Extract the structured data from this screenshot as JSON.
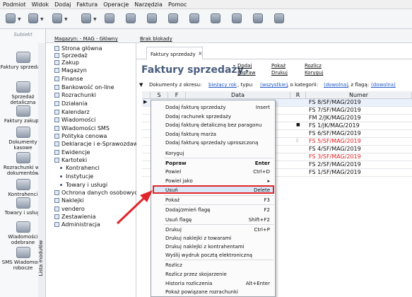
{
  "menubar": [
    "Podmiot",
    "Widok",
    "Dodaj",
    "Faktura",
    "Operacje",
    "Narzędzia",
    "Pomoc"
  ],
  "subiekt": {
    "logo": "Subiekt",
    "items": [
      "Faktury sprzedaży",
      "Sprzedaż detaliczna",
      "Faktury zakupu",
      "Dokumenty kasowe",
      "Rozrachunki wg dokumentów",
      "Kontrahenci",
      "Towary i usługi",
      "Wiadomości odebrane",
      "SMS Wiadomości robocze"
    ]
  },
  "magbar": {
    "magazyn": "Magazyn: - MAG - Główny",
    "blokady": "Brak blokady"
  },
  "vtab": "Lista modułów",
  "tree": {
    "items": [
      "Strona główna",
      "Sprzedaż",
      "Zakup",
      "Magazyn",
      "Finanse",
      "Bankowość on-line",
      "Rozrachunki",
      "Działania",
      "Kalendarz",
      "Wiadomości",
      "Wiadomości SMS",
      "Polityka cenowa",
      "Deklaracje i e-Sprawozdawczość",
      "Ewidencje",
      "Kartoteki"
    ],
    "sub": [
      "Kontrahenci",
      "Instytucje",
      "Towary i usługi"
    ],
    "items2": [
      "Ochrona danych osobowych",
      "Naklejki",
      "vendero",
      "Zestawienia",
      "Administracja"
    ]
  },
  "tab": {
    "label": "Faktury sprzedaży",
    "close": "×"
  },
  "title": "Faktury sprzedaży",
  "header_links": {
    "dodaj": "Dodaj",
    "popraw": "Popraw",
    "pokaz": "Pokaż",
    "drukuj": "Drukuj",
    "rozlicz": "Rozlicz",
    "koryguj": "Koryguj"
  },
  "filter": {
    "label1": "Dokumenty z okresu:",
    "okres": "bieżący rok",
    "label2": ", typu:",
    "typ": "(wszystkie)",
    "label3": ", o kategorii:",
    "kategoria": "(dowolna)",
    "label4": ", z flagą:",
    "flaga": "(dowolna)"
  },
  "grid": {
    "headers": [
      "S",
      "F",
      "Data",
      "R",
      "Numer"
    ],
    "rows": [
      {
        "numer": "FS 8/SF/MAG/2019",
        "color": "#111111"
      },
      {
        "numer": "FS 7/SF/MAG/2019",
        "color": "#111111"
      },
      {
        "numer": "FM 2/JK/MAG/2019",
        "color": "#111111"
      },
      {
        "numer": "FS 1/JK/MAG/2019",
        "color": "#111111"
      },
      {
        "numer": "FS 6/SF/MAG/2019",
        "color": "#111111"
      },
      {
        "numer": "FS 5/SF/MAG/2019",
        "color": "#e02020"
      },
      {
        "numer": "FS 4/SF/MAG/2019",
        "color": "#111111"
      },
      {
        "numer": "FS 3/SF/MAG/2019",
        "color": "#e02020"
      },
      {
        "numer": "FS 2/SF/MAG/2019",
        "color": "#111111"
      },
      {
        "numer": "FS 1/SF/MAG/2019",
        "color": "#111111"
      }
    ]
  },
  "menu": [
    {
      "label": "Dodaj fakturę sprzedaży",
      "sc": "Insert"
    },
    {
      "label": "Dodaj rachunek sprzedaży",
      "sc": ""
    },
    {
      "label": "Dodaj fakturę detaliczną bez paragonu",
      "sc": ""
    },
    {
      "label": "Dodaj fakturę marża",
      "sc": ""
    },
    {
      "label": "Dodaj fakturę sprzedaży uproszczoną",
      "sc": ""
    },
    {
      "label": "Koryguj",
      "sc": ""
    },
    {
      "label": "Popraw",
      "sc": "Enter"
    },
    {
      "label": "Powiel",
      "sc": "Ctrl+D"
    },
    {
      "label": "Powiel jako",
      "sc": "▸"
    },
    {
      "label": "Usuń",
      "sc": "Delete"
    },
    {
      "label": "Pokaż",
      "sc": "F3"
    },
    {
      "label": "Dodaj/zmień flagę",
      "sc": "F2"
    },
    {
      "label": "Usuń flagę",
      "sc": "Shift+F2"
    },
    {
      "label": "Drukuj",
      "sc": "Ctrl+P"
    },
    {
      "label": "Drukuj naklejki z towarami",
      "sc": ""
    },
    {
      "label": "Drukuj naklejki z kontrahentami",
      "sc": ""
    },
    {
      "label": "Wyślij wydruk pocztą elektroniczną",
      "sc": ""
    },
    {
      "label": "Rozlicz",
      "sc": ""
    },
    {
      "label": "Rozlicz przez skojarzenie",
      "sc": ""
    },
    {
      "label": "Historia rozliczenia",
      "sc": "Alt+Enter"
    },
    {
      "label": "Pokaż powiązane rozrachunki",
      "sc": ""
    }
  ],
  "colors": {
    "highlight_border": "#e0262a",
    "arrow": "#e0262a",
    "title": "#4a5e7e"
  }
}
